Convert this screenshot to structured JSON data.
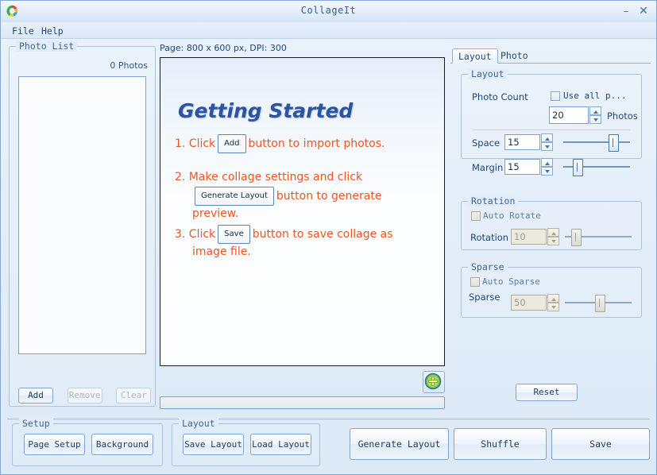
{
  "window": {
    "title": "CollageIt",
    "logo_icon": "collageit-logo-icon",
    "minimize_label": "–",
    "close_label": "✕"
  },
  "menubar": {
    "items": [
      {
        "label": "File"
      },
      {
        "label": "Help"
      }
    ]
  },
  "photo_list": {
    "group_label": "Photo List",
    "count_label": "0 Photos",
    "buttons": [
      {
        "label": "Add",
        "enabled": true
      },
      {
        "label": "Remove",
        "enabled": false
      },
      {
        "label": "Clear",
        "enabled": false
      }
    ]
  },
  "preview": {
    "page_info": "Page: 800 x 600 px, DPI: 300",
    "getting_started_title": "Getting Started",
    "steps": [
      {
        "number": "1. Click",
        "button": "Add",
        "after": "button to import photos."
      },
      {
        "number": "2. Make collage settings and click",
        "button": "Generate Layout",
        "after": "button to generate",
        "after2": "preview."
      },
      {
        "number": "3. Click",
        "button": "Save",
        "after": "button to save collage as",
        "after2": "image file."
      }
    ],
    "zoom_in_icon": "zoom-in-plus-icon",
    "progress_value": ""
  },
  "right_panel": {
    "tabs": [
      {
        "label": "Layout",
        "active": true
      },
      {
        "label": "Photo",
        "active": false
      }
    ],
    "layout": {
      "group_label": "Layout",
      "photo_count_label": "Photo Count",
      "use_all_checkbox_label": "Use all p...",
      "use_all_checked": false,
      "photo_count_value": "20",
      "photos_unit": "Photos",
      "space_label": "Space",
      "space_value": "15",
      "space_slider_percent": 72,
      "margin_label": "Margin",
      "margin_value": "15",
      "margin_slider_percent": 18
    },
    "rotation": {
      "group_label": "Rotation",
      "auto_rotate_label": "Auto Rotate",
      "auto_rotate_checked": false,
      "rotation_label": "Rotation",
      "rotation_value": "10",
      "rotation_slider_percent": 12,
      "enabled": false
    },
    "sparse": {
      "group_label": "Sparse",
      "auto_sparse_label": "Auto Sparse",
      "auto_sparse_checked": false,
      "sparse_label": "Sparse",
      "sparse_value": "50",
      "sparse_slider_percent": 48,
      "enabled": false
    },
    "reset_label": "Reset"
  },
  "bottom": {
    "setup_group_label": "Setup",
    "page_setup_label": "Page Setup",
    "background_label": "Background",
    "layout_group_label": "Layout",
    "save_layout_label": "Save Layout",
    "load_layout_label": "Load Layout",
    "generate_layout_label": "Generate Layout",
    "shuffle_label": "Shuffle",
    "save_label": "Save"
  },
  "colors": {
    "accent_blue": "#2b55a3",
    "step_orange": "#ee5522",
    "window_bg": "#e3edf9",
    "border_blue": "#7ea6ce"
  }
}
